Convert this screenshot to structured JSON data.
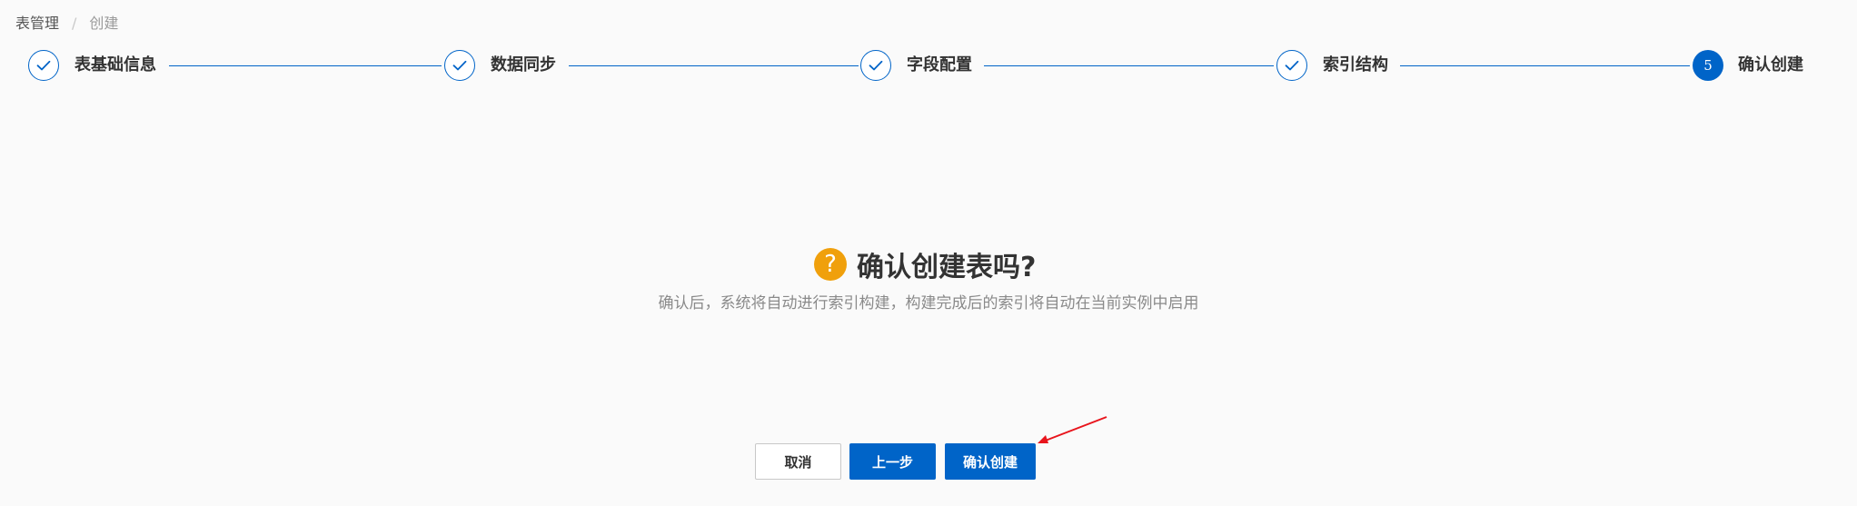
{
  "breadcrumb": {
    "items": [
      "表管理",
      "创建"
    ],
    "separator": "/"
  },
  "steps": [
    {
      "label": "表基础信息",
      "status": "done"
    },
    {
      "label": "数据同步",
      "status": "done"
    },
    {
      "label": "字段配置",
      "status": "done"
    },
    {
      "label": "索引结构",
      "status": "done"
    },
    {
      "label": "确认创建",
      "status": "active",
      "number": "5"
    }
  ],
  "confirm": {
    "icon": "question-icon",
    "icon_glyph": "?",
    "title": "确认创建表吗?",
    "description": "确认后，系统将自动进行索引构建，构建完成后的索引将自动在当前实例中启用"
  },
  "buttons": {
    "cancel": "取消",
    "prev": "上一步",
    "confirm": "确认创建"
  },
  "colors": {
    "primary": "#0064c8",
    "warning": "#f0a00c",
    "annotation": "#e8141c"
  }
}
